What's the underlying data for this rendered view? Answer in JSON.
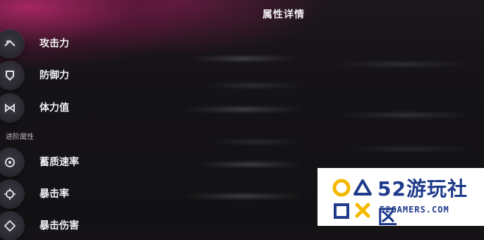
{
  "header": {
    "title": "属性详情"
  },
  "stats": [
    {
      "label": "攻击力",
      "icon": "attack-icon"
    },
    {
      "label": "防御力",
      "icon": "shield-icon"
    },
    {
      "label": "体力值",
      "icon": "stamina-icon"
    }
  ],
  "advanced": {
    "section_label": "进阶属性",
    "items": [
      {
        "label": "蓄质速率",
        "icon": "charge-rate-icon"
      },
      {
        "label": "暴击率",
        "icon": "crit-rate-icon"
      },
      {
        "label": "暴击伤害",
        "icon": "crit-damage-icon"
      }
    ]
  },
  "watermark": {
    "name": "52游玩社区",
    "url": "52GAMERS.COM",
    "brand_color": "#1f3a8a",
    "accent_color": "#f5b800"
  }
}
